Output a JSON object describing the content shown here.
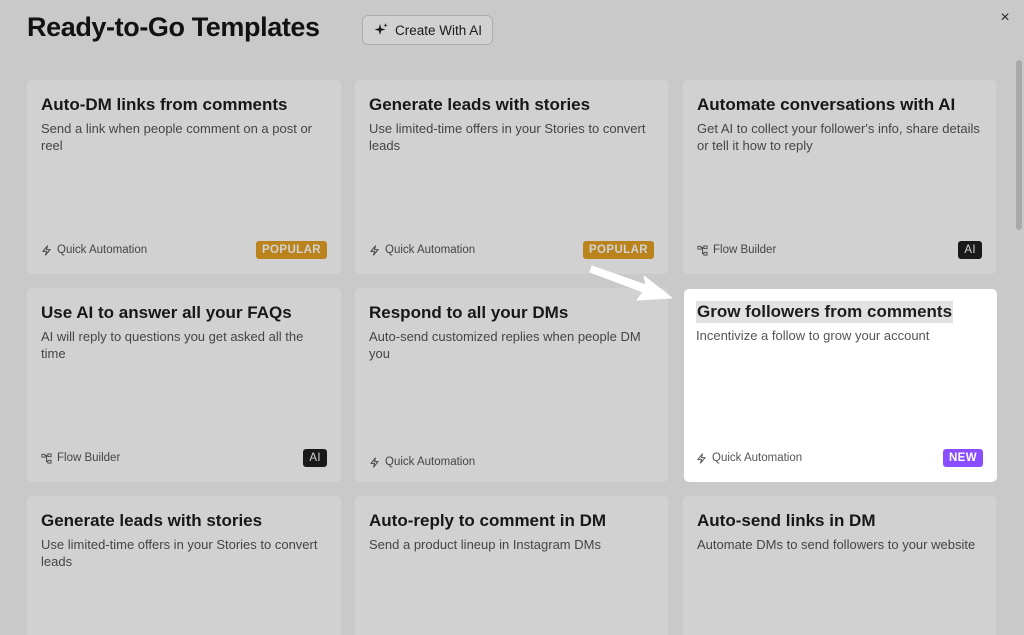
{
  "header": {
    "title": "Ready-to-Go Templates",
    "create_ai_label": "Create With AI",
    "create_ai_icon": "sparkle-icon",
    "close_icon": "close-icon",
    "close_label": "×"
  },
  "cards": [
    {
      "title": "Auto-DM links from comments",
      "desc": "Send a link when people comment on a post or reel",
      "type": "Quick Automation",
      "type_icon": "lightning-icon",
      "badge": "POPULAR"
    },
    {
      "title": "Generate leads with stories",
      "desc": "Use limited-time offers in your Stories to convert leads",
      "type": "Quick Automation",
      "type_icon": "lightning-icon",
      "badge": "POPULAR"
    },
    {
      "title": "Automate conversations with AI",
      "desc": "Get AI to collect your follower's info, share details or tell it how to reply",
      "type": "Flow Builder",
      "type_icon": "flow-icon",
      "badge": "AI"
    },
    {
      "title": "Use AI to answer all your FAQs",
      "desc": "AI will reply to questions you get asked all the time",
      "type": "Flow Builder",
      "type_icon": "flow-icon",
      "badge": "AI"
    },
    {
      "title": "Respond to all your DMs",
      "desc": "Auto-send customized replies when people DM you",
      "type": "Quick Automation",
      "type_icon": "lightning-icon",
      "badge": ""
    },
    {
      "title": "Grow followers from comments",
      "desc": "Incentivize a follow to grow your account",
      "type": "Quick Automation",
      "type_icon": "lightning-icon",
      "badge": "NEW"
    },
    {
      "title": "Generate leads with stories",
      "desc": "Use limited-time offers in your Stories to convert leads",
      "type": "",
      "type_icon": "",
      "badge": ""
    },
    {
      "title": "Auto-reply to comment in DM",
      "desc": "Send a product lineup in Instagram DMs",
      "type": "",
      "type_icon": "",
      "badge": ""
    },
    {
      "title": "Auto-send links in DM",
      "desc": "Automate DMs to send followers to your website",
      "type": "",
      "type_icon": "",
      "badge": ""
    }
  ],
  "colors": {
    "popular": "#e4a021",
    "ai": "#1f1f1f",
    "new": "#8a4dff"
  }
}
